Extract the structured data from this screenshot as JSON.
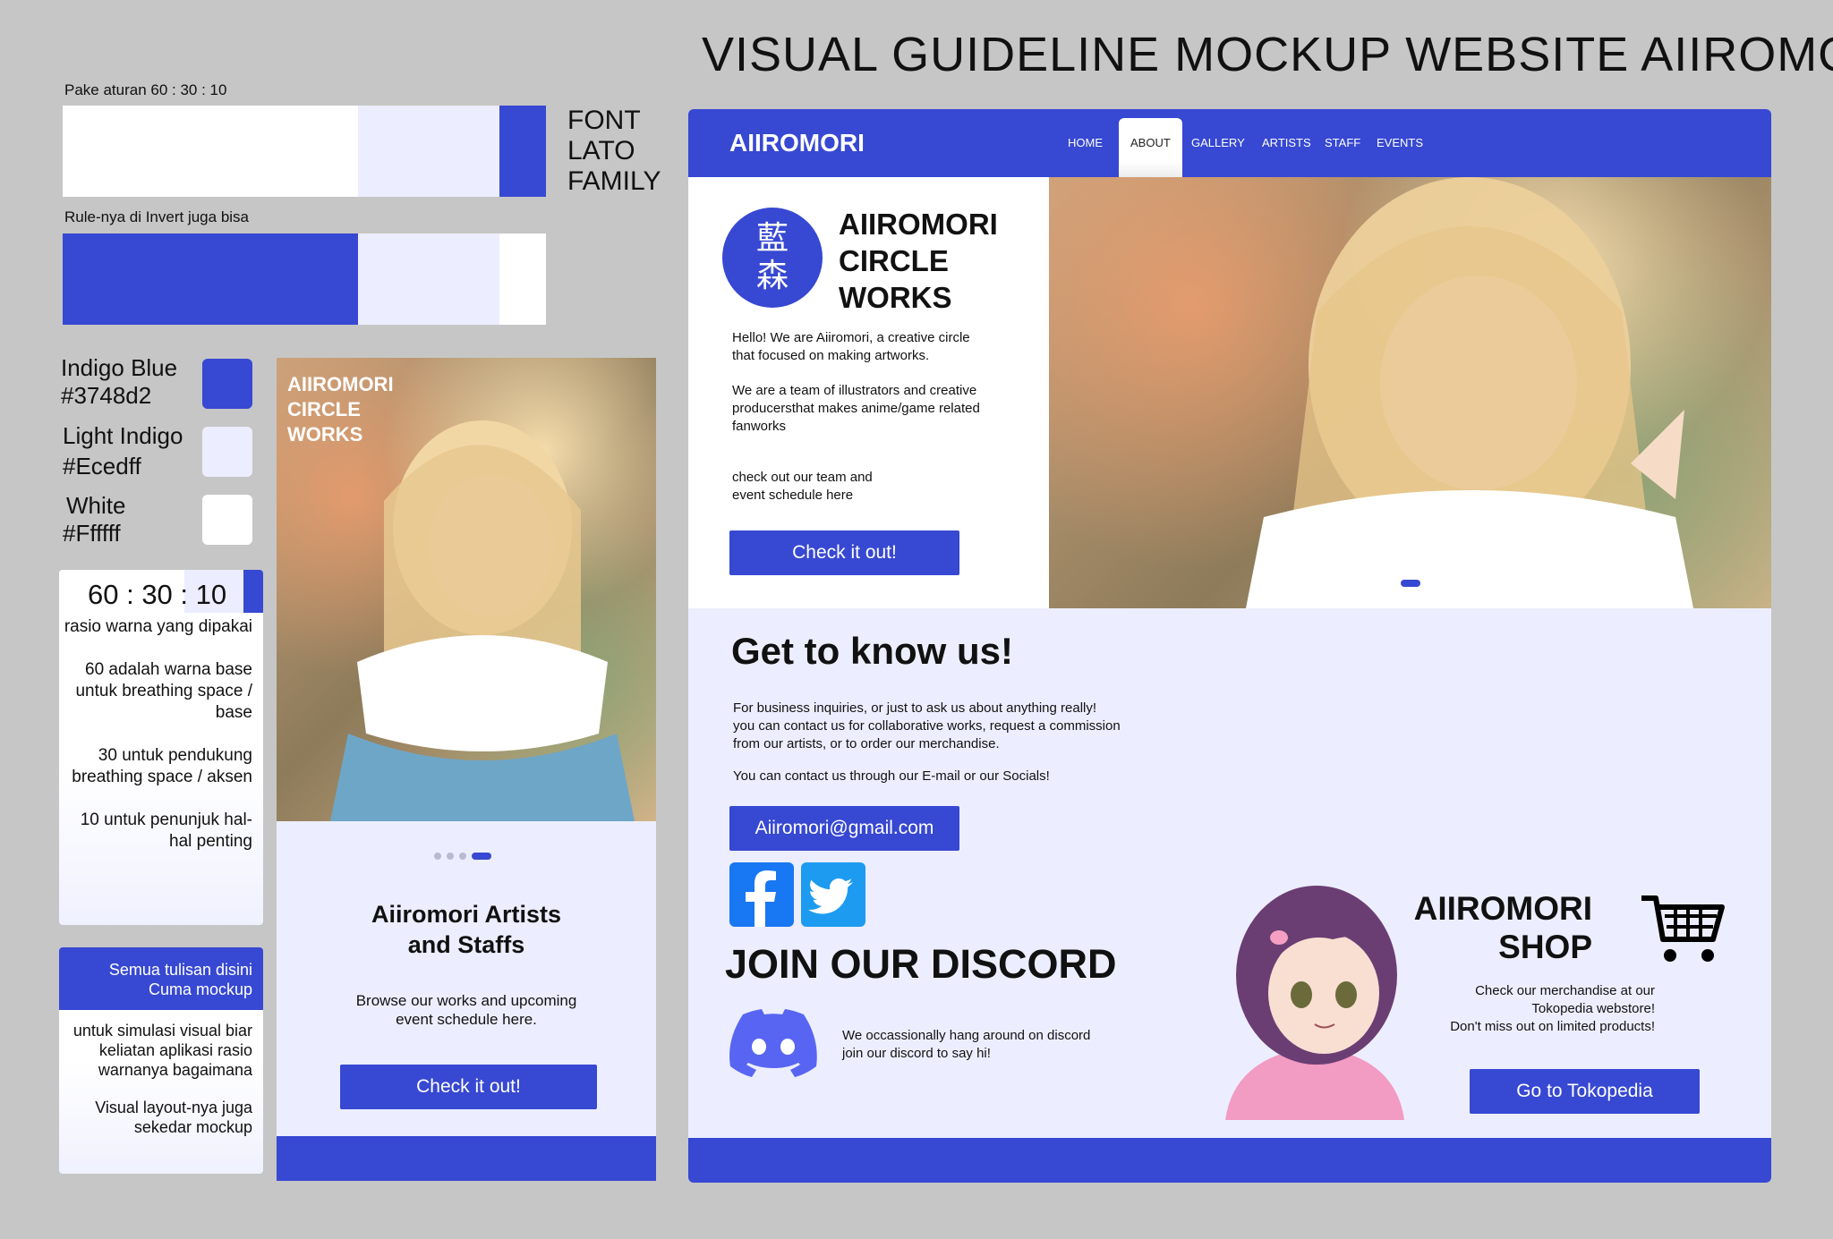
{
  "page_title": "VISUAL GUIDELINE MOCKUP WEBSITE AIIROMORI",
  "guide": {
    "rule_label": "Pake aturan 60 : 30 : 10",
    "invert_label": "Rule-nya di Invert juga bisa",
    "font_lines": [
      "FONT",
      "LATO",
      "FAMILY"
    ],
    "colors": [
      {
        "name": "Indigo Blue",
        "code": "#3748d2",
        "hex": "#3748d2"
      },
      {
        "name": "Light Indigo",
        "code": "#Ecedff",
        "hex": "#ecedff"
      },
      {
        "name": "White",
        "code": "#Ffffff",
        "hex": "#ffffff"
      }
    ],
    "ratio_title": "60 : 30 : 10",
    "ratio_notes": [
      "rasio warna yang dipakai",
      "60 adalah warna base untuk breathing space / base",
      "30 untuk pendukung breathing space / aksen",
      "10 untuk penunjuk hal-hal penting"
    ],
    "mockup_header": "Semua tulisan disini Cuma mockup",
    "mockup_notes": [
      "untuk simulasi visual biar keliatan aplikasi rasio warnanya bagaimana",
      "Visual layout-nya juga sekedar mockup"
    ]
  },
  "mobile": {
    "hero_title_lines": [
      "AIIROMORI",
      "CIRCLE",
      "WORKS"
    ],
    "section_title_lines": [
      "Aiiromori Artists",
      "and Staffs"
    ],
    "section_text_lines": [
      "Browse our works and upcoming",
      "event schedule here."
    ],
    "cta_label": "Check it out!"
  },
  "desktop": {
    "logo": "AIIROMORI",
    "nav_items": [
      "HOME",
      "ABOUT",
      "GALLERY",
      "ARTISTS",
      "STAFF",
      "EVENTS"
    ],
    "nav_active": "ABOUT",
    "kanji": "藍森",
    "hero_title_lines": [
      "AIIROMORI",
      "CIRCLE",
      "WORKS"
    ],
    "intro_lines": [
      "Hello! We are Aiiromori, a creative circle",
      "that focused on making artworks."
    ],
    "team_lines": [
      "We are a team of illustrators and creative",
      "producersthat makes anime/game related",
      "fanworks"
    ],
    "schedule_lines": [
      "check out our team and",
      "event schedule here"
    ],
    "cta_label": "Check it out!",
    "know_title": "Get to know us!",
    "know_lines": [
      "For business inquiries, or just to ask us about anything really!",
      "you can contact us for collaborative works, request a commission",
      "from our artists, or to order our merchandise."
    ],
    "contact_line": "You can contact us through our E-mail or our Socials!",
    "email": "Aiiromori@gmail.com",
    "discord_title": "JOIN OUR DISCORD",
    "discord_lines": [
      "We occassionally hang around on discord",
      "join our discord to say hi!"
    ],
    "shop_title_lines": [
      "AIIROMORI",
      "SHOP"
    ],
    "shop_lines": [
      "Check our merchandise at our",
      "Tokopedia webstore!",
      "Don't miss out on limited products!"
    ],
    "shop_cta": "Go to Tokopedia"
  }
}
